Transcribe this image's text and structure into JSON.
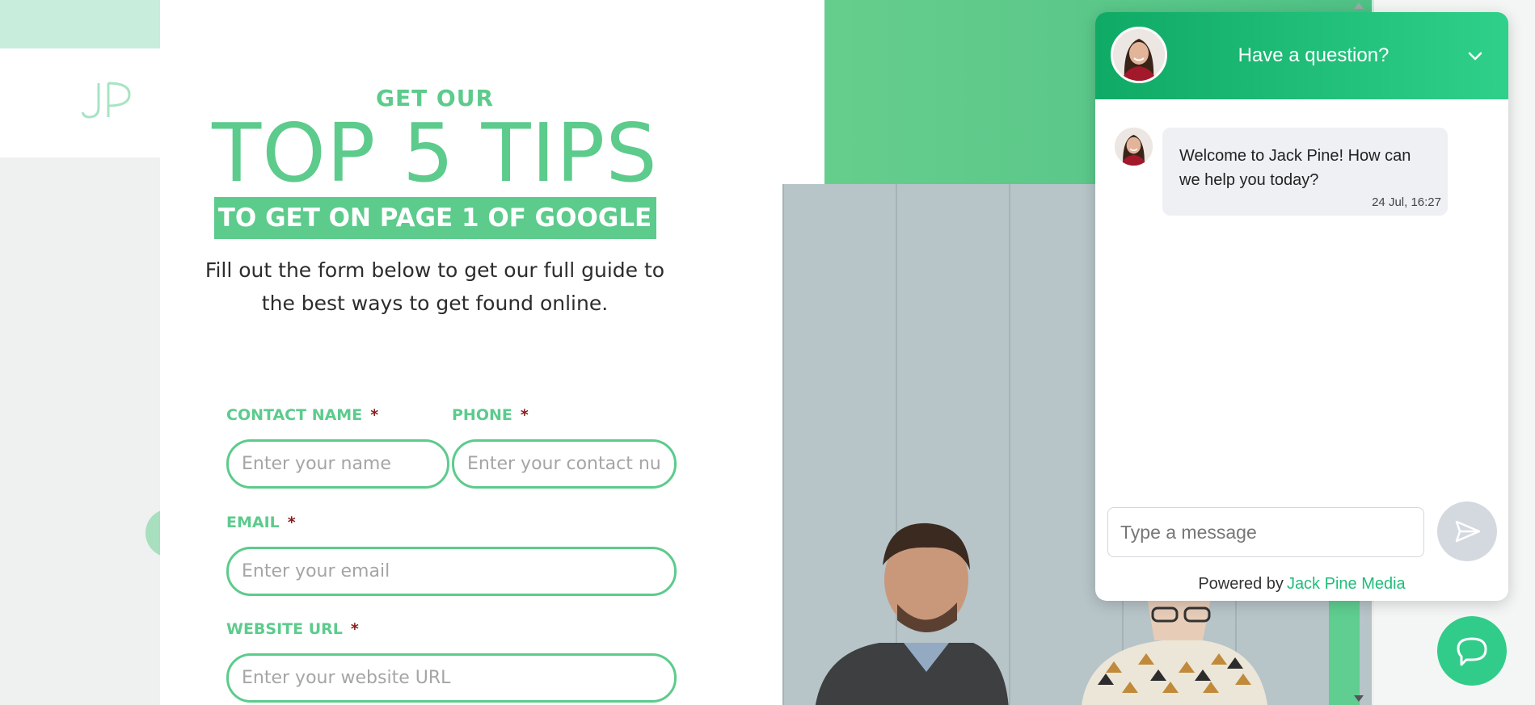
{
  "background": {
    "logo_text": "JP"
  },
  "hero": {
    "get_our": "GET OUR",
    "top_tips": "TOP 5 TIPS",
    "band": "TO GET ON PAGE 1 OF GOOGLE",
    "subtitle": "Fill out the form below to get our full guide to the best ways to get found online."
  },
  "form": {
    "contact_name": {
      "label": "CONTACT NAME",
      "required": "*",
      "placeholder": "Enter your name"
    },
    "phone": {
      "label": "PHONE",
      "required": "*",
      "placeholder": "Enter your contact number"
    },
    "email": {
      "label": "EMAIL",
      "required": "*",
      "placeholder": "Enter your email"
    },
    "website": {
      "label": "WEBSITE URL",
      "required": "*",
      "placeholder": "Enter your website URL"
    }
  },
  "chat": {
    "title": "Have a question?",
    "message": "Welcome to Jack Pine! How can we help you today?",
    "timestamp": "24 Jul, 16:27",
    "input_placeholder": "Type a message",
    "powered_by": "Powered by",
    "brand": "Jack Pine Media",
    "icons": {
      "collapse": "chevron-down-icon",
      "send": "send-icon",
      "launcher": "chat-bubble-icon"
    }
  },
  "colors": {
    "brand_green": "#5ccb8c",
    "chat_header": "#0faa65",
    "required": "#8b1a1a",
    "launcher": "#32cc8a"
  }
}
